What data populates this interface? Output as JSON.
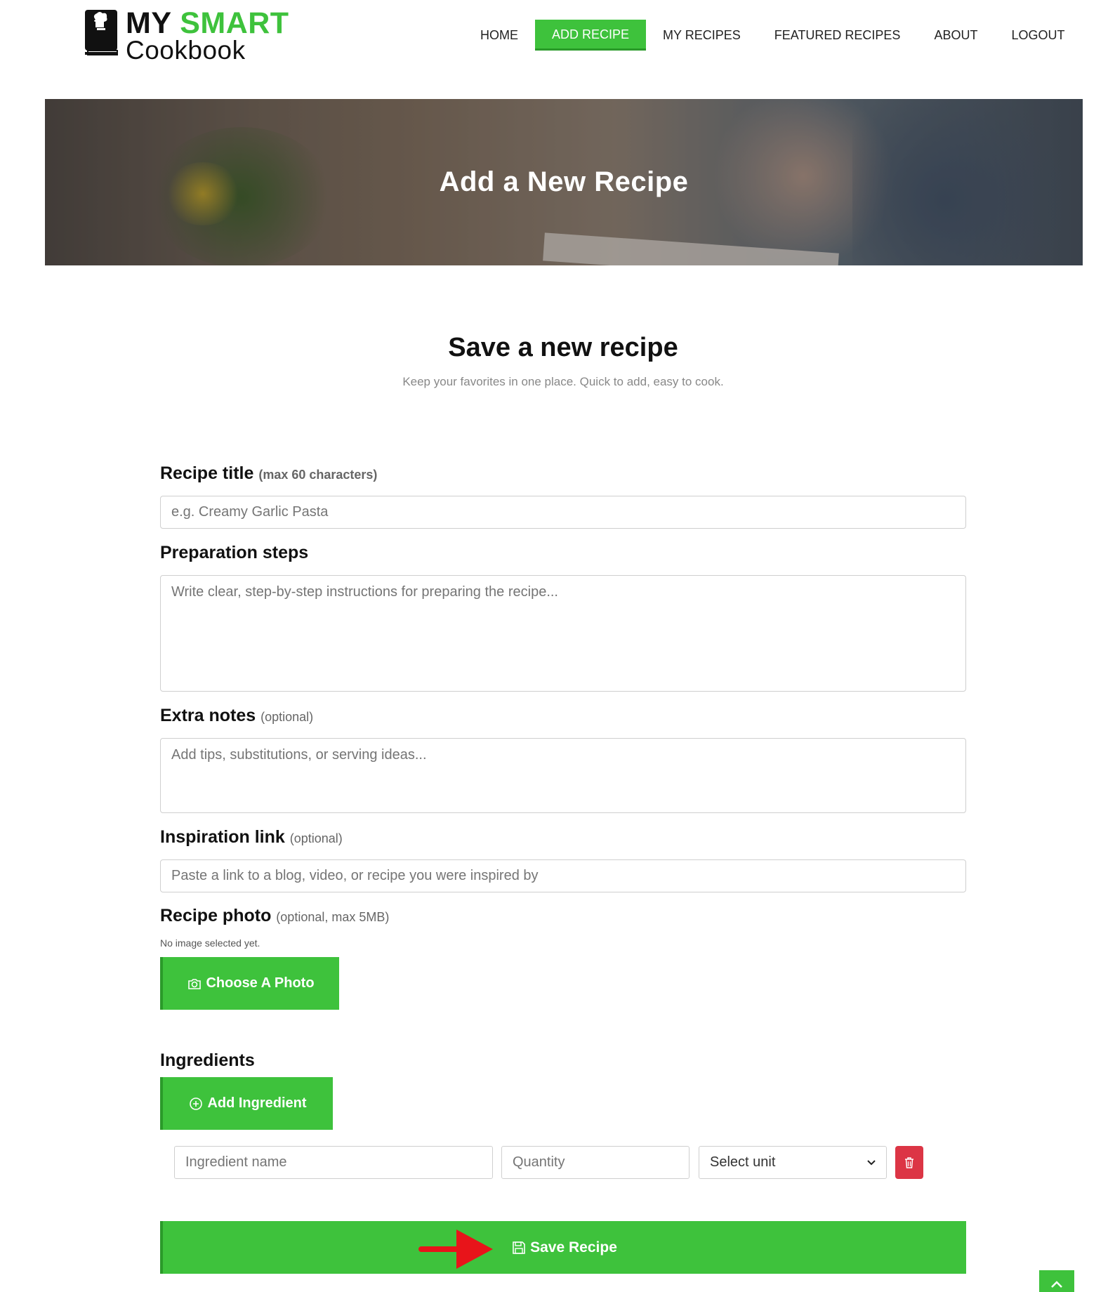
{
  "brand": {
    "word1": "MY",
    "word2": "SMART",
    "word3": "Cookbook",
    "accent": "#3ec23c"
  },
  "nav": {
    "items": [
      {
        "label": "HOME",
        "active": false
      },
      {
        "label": "ADD RECIPE",
        "active": true
      },
      {
        "label": "MY RECIPES",
        "active": false
      },
      {
        "label": "FEATURED RECIPES",
        "active": false
      },
      {
        "label": "ABOUT",
        "active": false
      },
      {
        "label": "LOGOUT",
        "active": false
      }
    ]
  },
  "banner": {
    "title": "Add a New Recipe"
  },
  "intro": {
    "title": "Save a new recipe",
    "subtitle": "Keep your favorites in one place. Quick to add, easy to cook."
  },
  "form": {
    "title": {
      "label": "Recipe title",
      "hint": "(max 60 characters)",
      "placeholder": "e.g. Creamy Garlic Pasta"
    },
    "steps": {
      "label": "Preparation steps",
      "placeholder": "Write clear, step-by-step instructions for preparing the recipe..."
    },
    "notes": {
      "label": "Extra notes",
      "hint": "(optional)",
      "placeholder": "Add tips, substitutions, or serving ideas..."
    },
    "link": {
      "label": "Inspiration link",
      "hint": "(optional)",
      "placeholder": "Paste a link to a blog, video, or recipe you were inspired by"
    },
    "photo": {
      "label": "Recipe photo",
      "hint": "(optional, max 5MB)",
      "status": "No image selected yet.",
      "button_label": "Choose A Photo"
    },
    "ingredients": {
      "label": "Ingredients",
      "add_label": "Add Ingredient",
      "name_placeholder": "Ingredient name",
      "quantity_placeholder": "Quantity",
      "unit_selected": "Select unit"
    },
    "save_label": "Save Recipe"
  },
  "colors": {
    "green": "#3ec23c",
    "danger": "#dc3545",
    "arrow": "#e8141a"
  }
}
